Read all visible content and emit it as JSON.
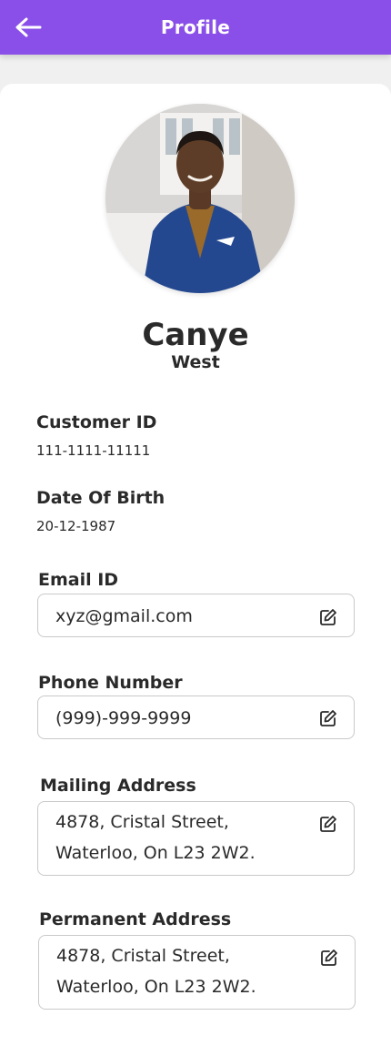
{
  "header": {
    "title": "Profile",
    "back_icon": "arrow-left-icon",
    "background": "#8a4fe8"
  },
  "profile": {
    "first_name": "Canye",
    "last_name": "West"
  },
  "fields": {
    "customer_id": {
      "label": "Customer ID",
      "value": "111-1111-11111"
    },
    "date_of_birth": {
      "label": "Date Of Birth",
      "value": "20-12-1987"
    },
    "email": {
      "label": "Email ID",
      "value": "xyz@gmail.com",
      "edit_icon": "pencil-square-icon"
    },
    "phone": {
      "label": "Phone Number",
      "value": "(999)-999-9999",
      "edit_icon": "pencil-square-icon"
    },
    "mailing_address": {
      "label": "Mailing Address",
      "line1": "4878, Cristal Street,",
      "line2": "Waterloo, On L23 2W2.",
      "edit_icon": "pencil-square-icon"
    },
    "permanent_address": {
      "label": "Permanent Address",
      "line1": "4878, Cristal Street,",
      "line2": "Waterloo, On L23 2W2.",
      "edit_icon": "pencil-square-icon"
    }
  }
}
